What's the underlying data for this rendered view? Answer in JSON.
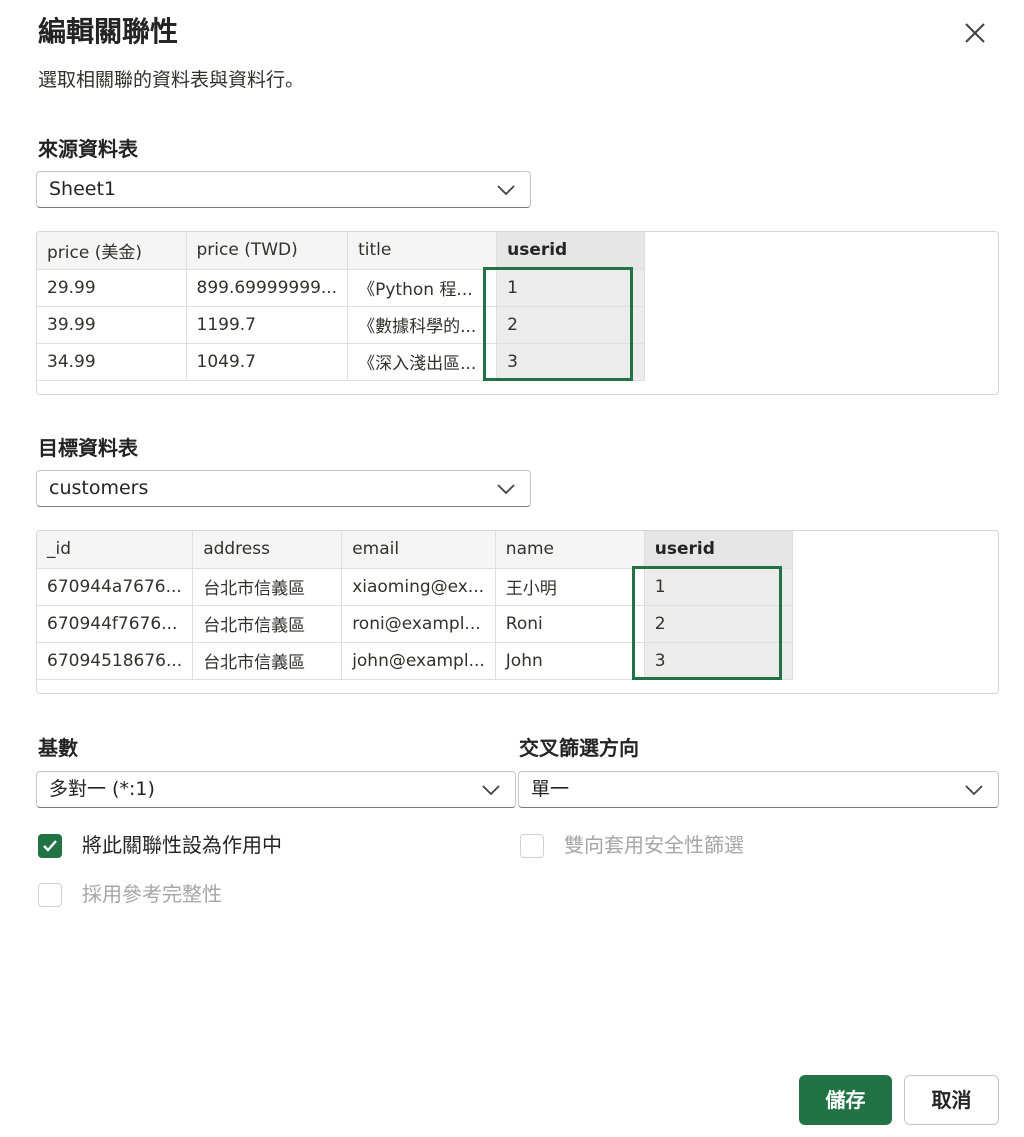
{
  "dialog": {
    "title": "編輯關聯性",
    "subtitle": "選取相關聯的資料表與資料行。"
  },
  "source": {
    "label": "來源資料表",
    "selected": "Sheet1",
    "columns": [
      "price (美金)",
      "price (TWD)",
      "title",
      "userid"
    ],
    "rows": [
      [
        "29.99",
        "899.69999999...",
        "《Python 程...",
        "1"
      ],
      [
        "39.99",
        "1199.7",
        "《數據科學的...",
        "2"
      ],
      [
        "34.99",
        "1049.7",
        "《深入淺出區...",
        "3"
      ]
    ],
    "key_column": "userid"
  },
  "target": {
    "label": "目標資料表",
    "selected": "customers",
    "columns": [
      "_id",
      "address",
      "email",
      "name",
      "userid"
    ],
    "rows": [
      [
        "670944a7676...",
        "台北市信義區",
        "xiaoming@ex...",
        "王小明",
        "1"
      ],
      [
        "670944f7676...",
        "台北市信義區",
        "roni@exampl...",
        "Roni",
        "2"
      ],
      [
        "67094518676...",
        "台北市信義區",
        "john@exampl...",
        "John",
        "3"
      ]
    ],
    "key_column": "userid"
  },
  "cardinality": {
    "label": "基數",
    "selected": "多對一 (*:1)"
  },
  "cross_filter": {
    "label": "交叉篩選方向",
    "selected": "單一"
  },
  "options": {
    "active": {
      "label": "將此關聯性設為作用中",
      "checked": true
    },
    "bidirectional_security": {
      "label": "雙向套用安全性篩選",
      "checked": false
    },
    "referential_integrity": {
      "label": "採用參考完整性",
      "checked": false
    }
  },
  "buttons": {
    "save": "儲存",
    "cancel": "取消"
  },
  "colors": {
    "accent": "#217346",
    "disabled_text": "#a6a6a6"
  }
}
